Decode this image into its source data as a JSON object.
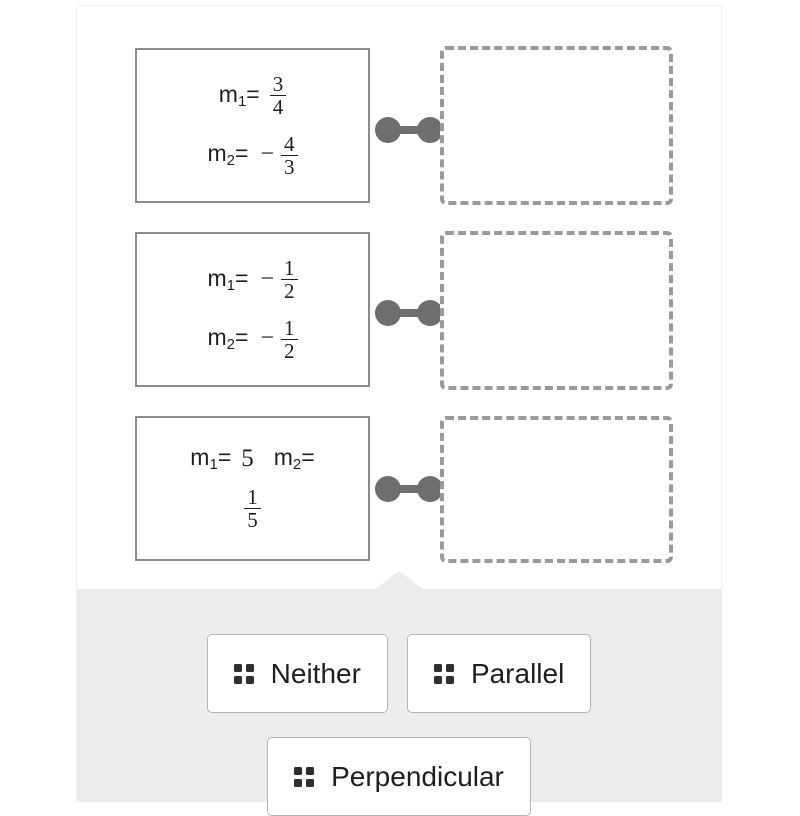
{
  "exercise": {
    "type": "drag-and-drop-matching",
    "prompts": [
      {
        "id": "pair-1",
        "lines": [
          {
            "label": "m",
            "subscript": "1",
            "equals": "=",
            "sign": "",
            "numerator": "3",
            "denominator": "4"
          },
          {
            "label": "m",
            "subscript": "2",
            "equals": "=",
            "sign": "−",
            "numerator": "4",
            "denominator": "3"
          }
        ],
        "drop_zone_label": ""
      },
      {
        "id": "pair-2",
        "lines": [
          {
            "label": "m",
            "subscript": "1",
            "equals": "=",
            "sign": "−",
            "numerator": "1",
            "denominator": "2"
          },
          {
            "label": "m",
            "subscript": "2",
            "equals": "=",
            "sign": "−",
            "numerator": "1",
            "denominator": "2"
          }
        ],
        "drop_zone_label": ""
      },
      {
        "id": "pair-3",
        "inline": {
          "first_label": "m",
          "first_subscript": "1",
          "first_equals": "=",
          "first_value": "5",
          "second_label": "m",
          "second_subscript": "2",
          "second_equals": "=",
          "numerator": "1",
          "denominator": "5"
        },
        "drop_zone_label": ""
      }
    ],
    "answer_choices": [
      {
        "id": "choice-neither",
        "label": "Neither",
        "handle_icon": "drag-handle-icon"
      },
      {
        "id": "choice-parallel",
        "label": "Parallel",
        "handle_icon": "drag-handle-icon"
      },
      {
        "id": "choice-perpendicular",
        "label": "Perpendicular",
        "handle_icon": "drag-handle-icon"
      }
    ],
    "colors": {
      "panel_background": "#ffffff",
      "tray_background": "#ececec",
      "card_border": "#8b8b8b",
      "dropzone_border": "#9a9a9a",
      "connector": "#6e6e6e",
      "chip_border": "#b5b5b5",
      "text": "#1f1f1f",
      "dot": "#2e2e2e"
    }
  }
}
